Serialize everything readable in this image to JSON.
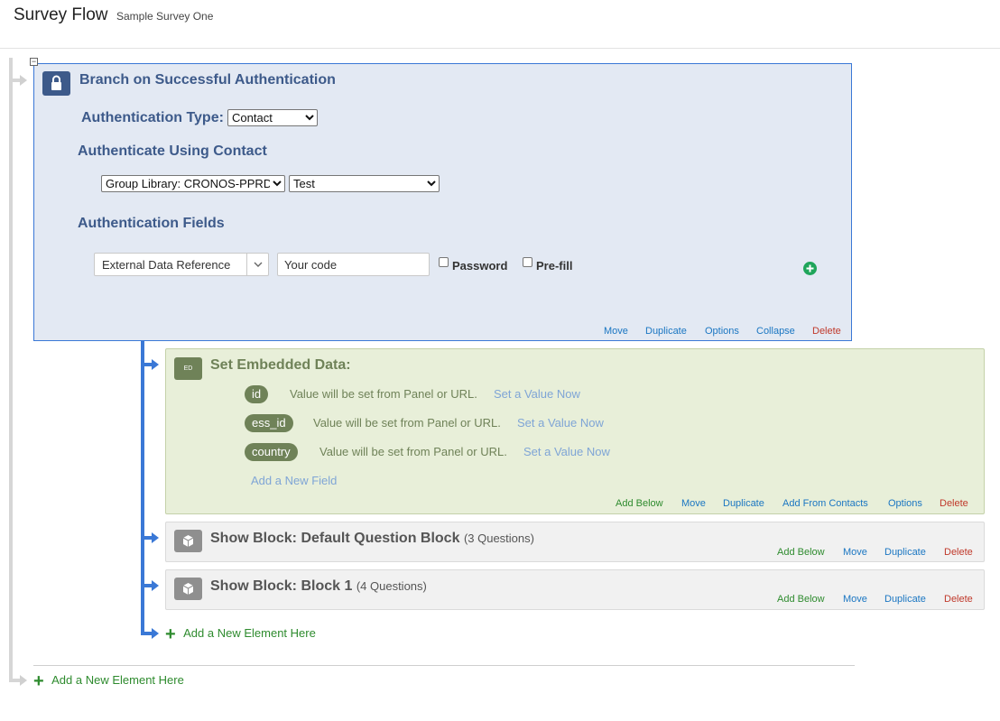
{
  "header": {
    "title": "Survey Flow",
    "survey_name": "Sample Survey One"
  },
  "branch": {
    "collapse_glyph": "−",
    "icon": "lock-icon",
    "title": "Branch on Successful Authentication",
    "auth_type_label": "Authentication Type:",
    "auth_type_value": "Contact",
    "auth_using_heading": "Authenticate Using Contact",
    "library_value": "Group Library: CRONOS-PPRD",
    "list_value": "Test",
    "auth_fields_heading": "Authentication Fields",
    "field_select_value": "External Data Reference",
    "field_input_value": "Your code",
    "password_label": "Password",
    "prefill_label": "Pre-fill",
    "actions": {
      "move": "Move",
      "duplicate": "Duplicate",
      "options": "Options",
      "collapse": "Collapse",
      "delete": "Delete"
    }
  },
  "embedded": {
    "badge": "ED",
    "title": "Set Embedded Data:",
    "fields": [
      {
        "name": "id",
        "value": "Value will be set from Panel or URL.",
        "link": "Set a Value Now"
      },
      {
        "name": "ess_id",
        "value": "Value will be set from Panel or URL.",
        "link": "Set a Value Now"
      },
      {
        "name": "country",
        "value": "Value will be set from Panel or URL.",
        "link": "Set a Value Now"
      }
    ],
    "add_field": "Add a New Field",
    "actions": {
      "add_below": "Add Below",
      "move": "Move",
      "duplicate": "Duplicate",
      "add_from_contacts": "Add From Contacts",
      "options": "Options",
      "delete": "Delete"
    }
  },
  "blocks": [
    {
      "title": "Show Block: Default Question Block",
      "count": "(3 Questions)",
      "actions": {
        "add_below": "Add Below",
        "move": "Move",
        "duplicate": "Duplicate",
        "delete": "Delete"
      }
    },
    {
      "title": "Show Block: Block 1",
      "count": "(4 Questions)",
      "actions": {
        "add_below": "Add Below",
        "move": "Move",
        "duplicate": "Duplicate",
        "delete": "Delete"
      }
    }
  ],
  "add_new_inner": "Add a New Element Here",
  "add_new_outer": "Add a New Element Here",
  "colors": {
    "branch_bg": "#e3e9f3",
    "branch_accent": "#3d5a8a",
    "flow_blue": "#3a78d6",
    "embedded_bg": "#e8efd9",
    "embedded_accent": "#6f8258",
    "block_bg": "#f1f1f1",
    "link_blue": "#1a76c2",
    "delete_red": "#c0392b",
    "add_green": "#2e8b2e"
  }
}
